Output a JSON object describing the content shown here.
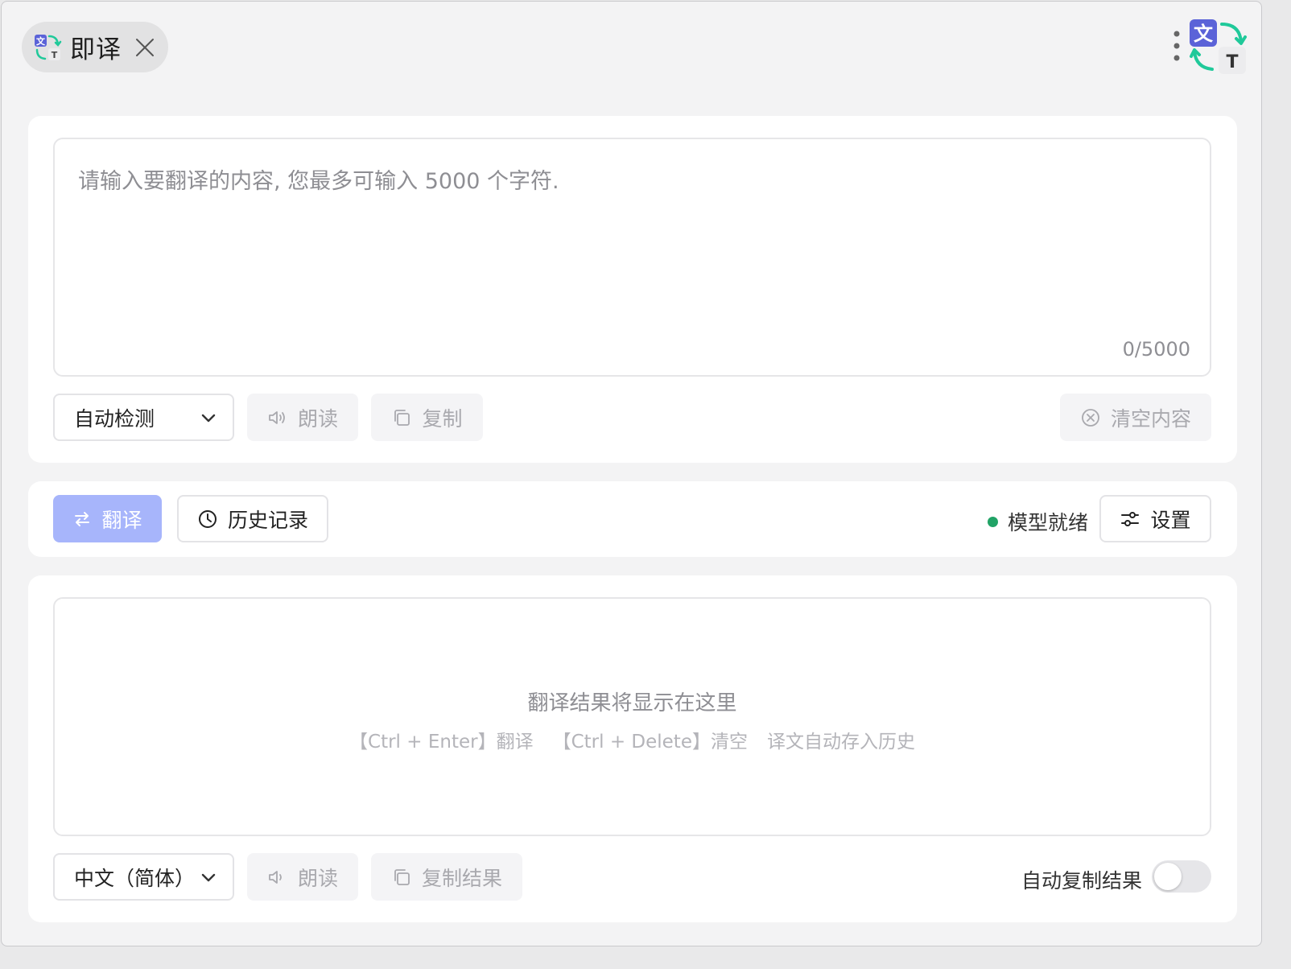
{
  "window": {
    "tab_title": "即译",
    "icons": {
      "app": "translate-app-icon",
      "close": "close-icon",
      "more": "more-vertical-icon",
      "logo": "translate-logo-icon"
    }
  },
  "input": {
    "placeholder": "请输入要翻译的内容, 您最多可输入 5000 个字符.",
    "value": "",
    "counter": "0/5000",
    "source_language": "自动检测",
    "read_label": "朗读",
    "copy_label": "复制",
    "clear_label": "清空内容"
  },
  "toolbar": {
    "translate_label": "翻译",
    "history_label": "历史记录",
    "status_text": "模型就绪",
    "settings_label": "设置"
  },
  "output": {
    "empty_title": "翻译结果将显示在这里",
    "hints": [
      "【Ctrl + Enter】翻译",
      "【Ctrl + Delete】清空",
      "译文自动存入历史"
    ],
    "target_language": "中文（简体）",
    "read_label": "朗读",
    "copy_label": "复制结果",
    "auto_copy_label": "自动复制结果",
    "auto_copy_enabled": false
  },
  "colors": {
    "primary_disabled": "#a7b5fb",
    "status_ok": "#21a366",
    "logo_blue": "#5b63d8",
    "logo_green": "#20c99a"
  }
}
